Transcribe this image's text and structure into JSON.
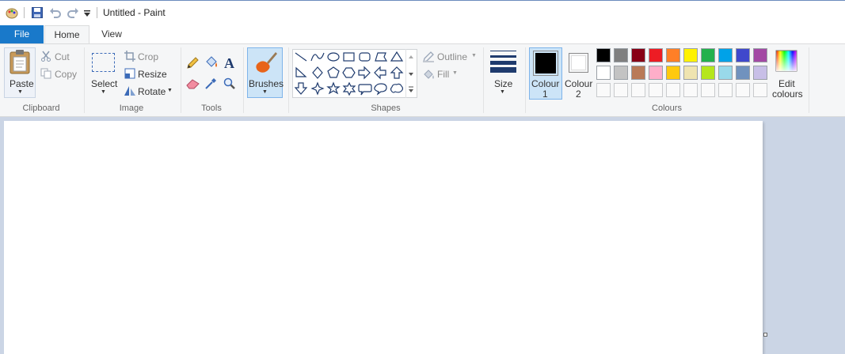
{
  "window": {
    "title": "Untitled - Paint"
  },
  "tabs": [
    {
      "label": "File"
    },
    {
      "label": "Home"
    },
    {
      "label": "View"
    }
  ],
  "clipboard": {
    "paste": "Paste",
    "cut": "Cut",
    "copy": "Copy",
    "group": "Clipboard"
  },
  "image": {
    "select": "Select",
    "crop": "Crop",
    "resize": "Resize",
    "rotate": "Rotate",
    "group": "Image"
  },
  "tools": {
    "group": "Tools"
  },
  "brushes": {
    "label": "Brushes"
  },
  "shapes": {
    "outline": "Outline",
    "fill": "Fill",
    "group": "Shapes"
  },
  "size": {
    "label": "Size"
  },
  "colours": {
    "colour1_label": "Colour",
    "colour1_num": "1",
    "colour2_label": "Colour",
    "colour2_num": "2",
    "edit_label1": "Edit",
    "edit_label2": "colours",
    "group": "Colours",
    "colour1_value": "#000000",
    "colour2_value": "#ffffff",
    "palette_row1": [
      "#000000",
      "#7f7f7f",
      "#880015",
      "#ed1c24",
      "#ff7f27",
      "#fff200",
      "#22b14c",
      "#00a2e8",
      "#3f48cc",
      "#a349a4"
    ],
    "palette_row2": [
      "#ffffff",
      "#c3c3c3",
      "#b97a57",
      "#ffaec9",
      "#ffc90e",
      "#efe4b0",
      "#b5e61d",
      "#99d9ea",
      "#7092be",
      "#c8bfe7"
    ]
  }
}
